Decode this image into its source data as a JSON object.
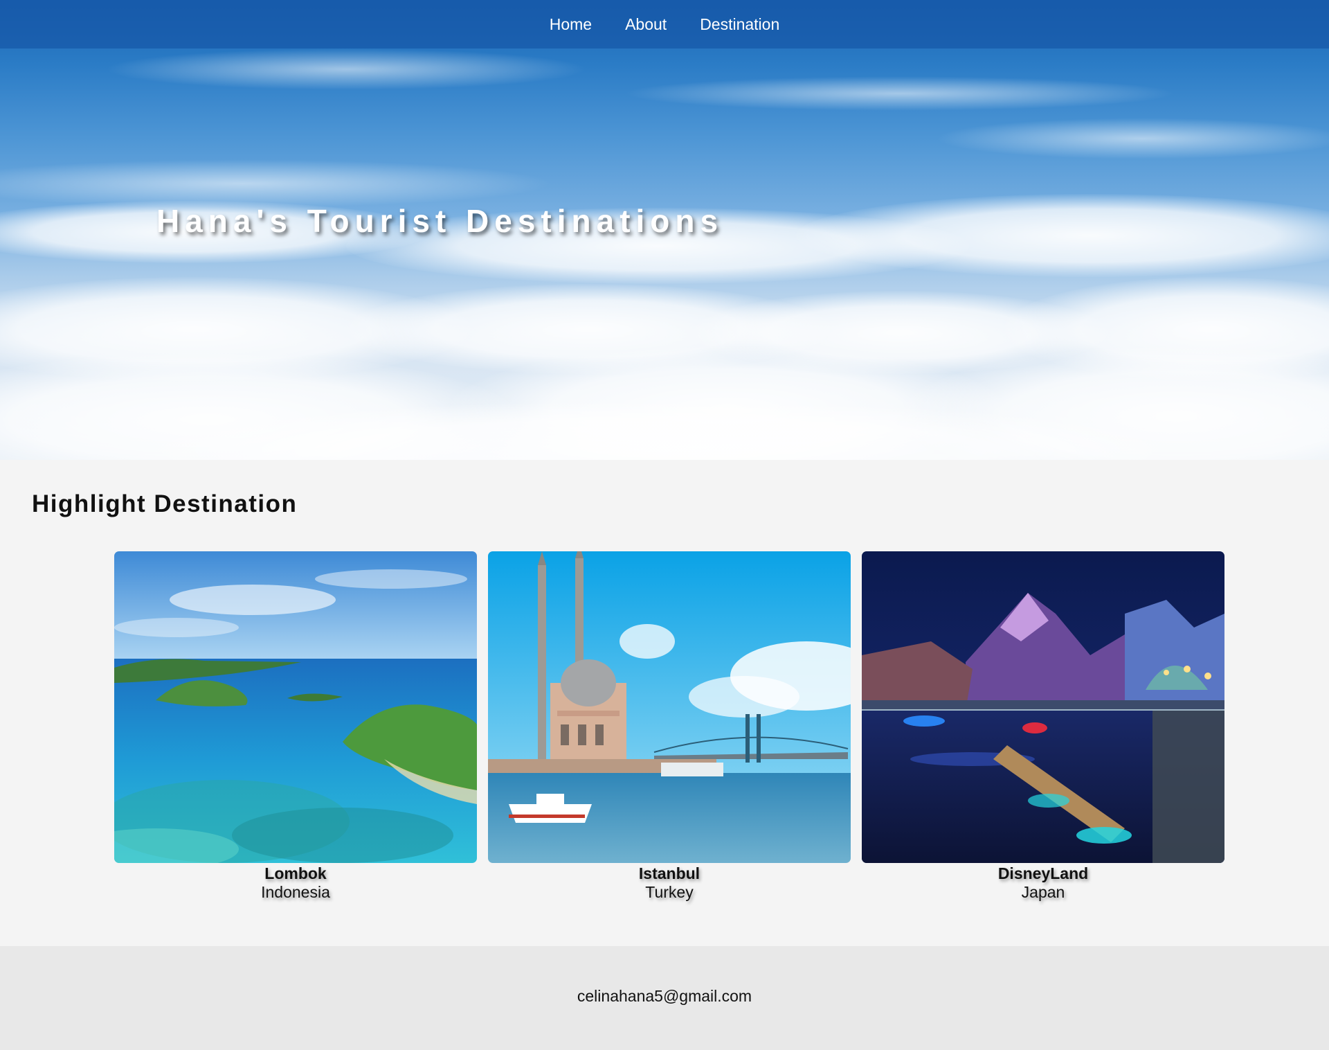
{
  "nav": {
    "items": [
      "Home",
      "About",
      "Destination"
    ]
  },
  "hero": {
    "title": "Hana's Tourist Destinations"
  },
  "highlight": {
    "title": "Highlight Destination",
    "destinations": [
      {
        "name": "Lombok",
        "country": "Indonesia"
      },
      {
        "name": "Istanbul",
        "country": "Turkey"
      },
      {
        "name": "DisneyLand",
        "country": "Japan"
      }
    ]
  },
  "footer": {
    "email": "celinahana5@gmail.com"
  }
}
